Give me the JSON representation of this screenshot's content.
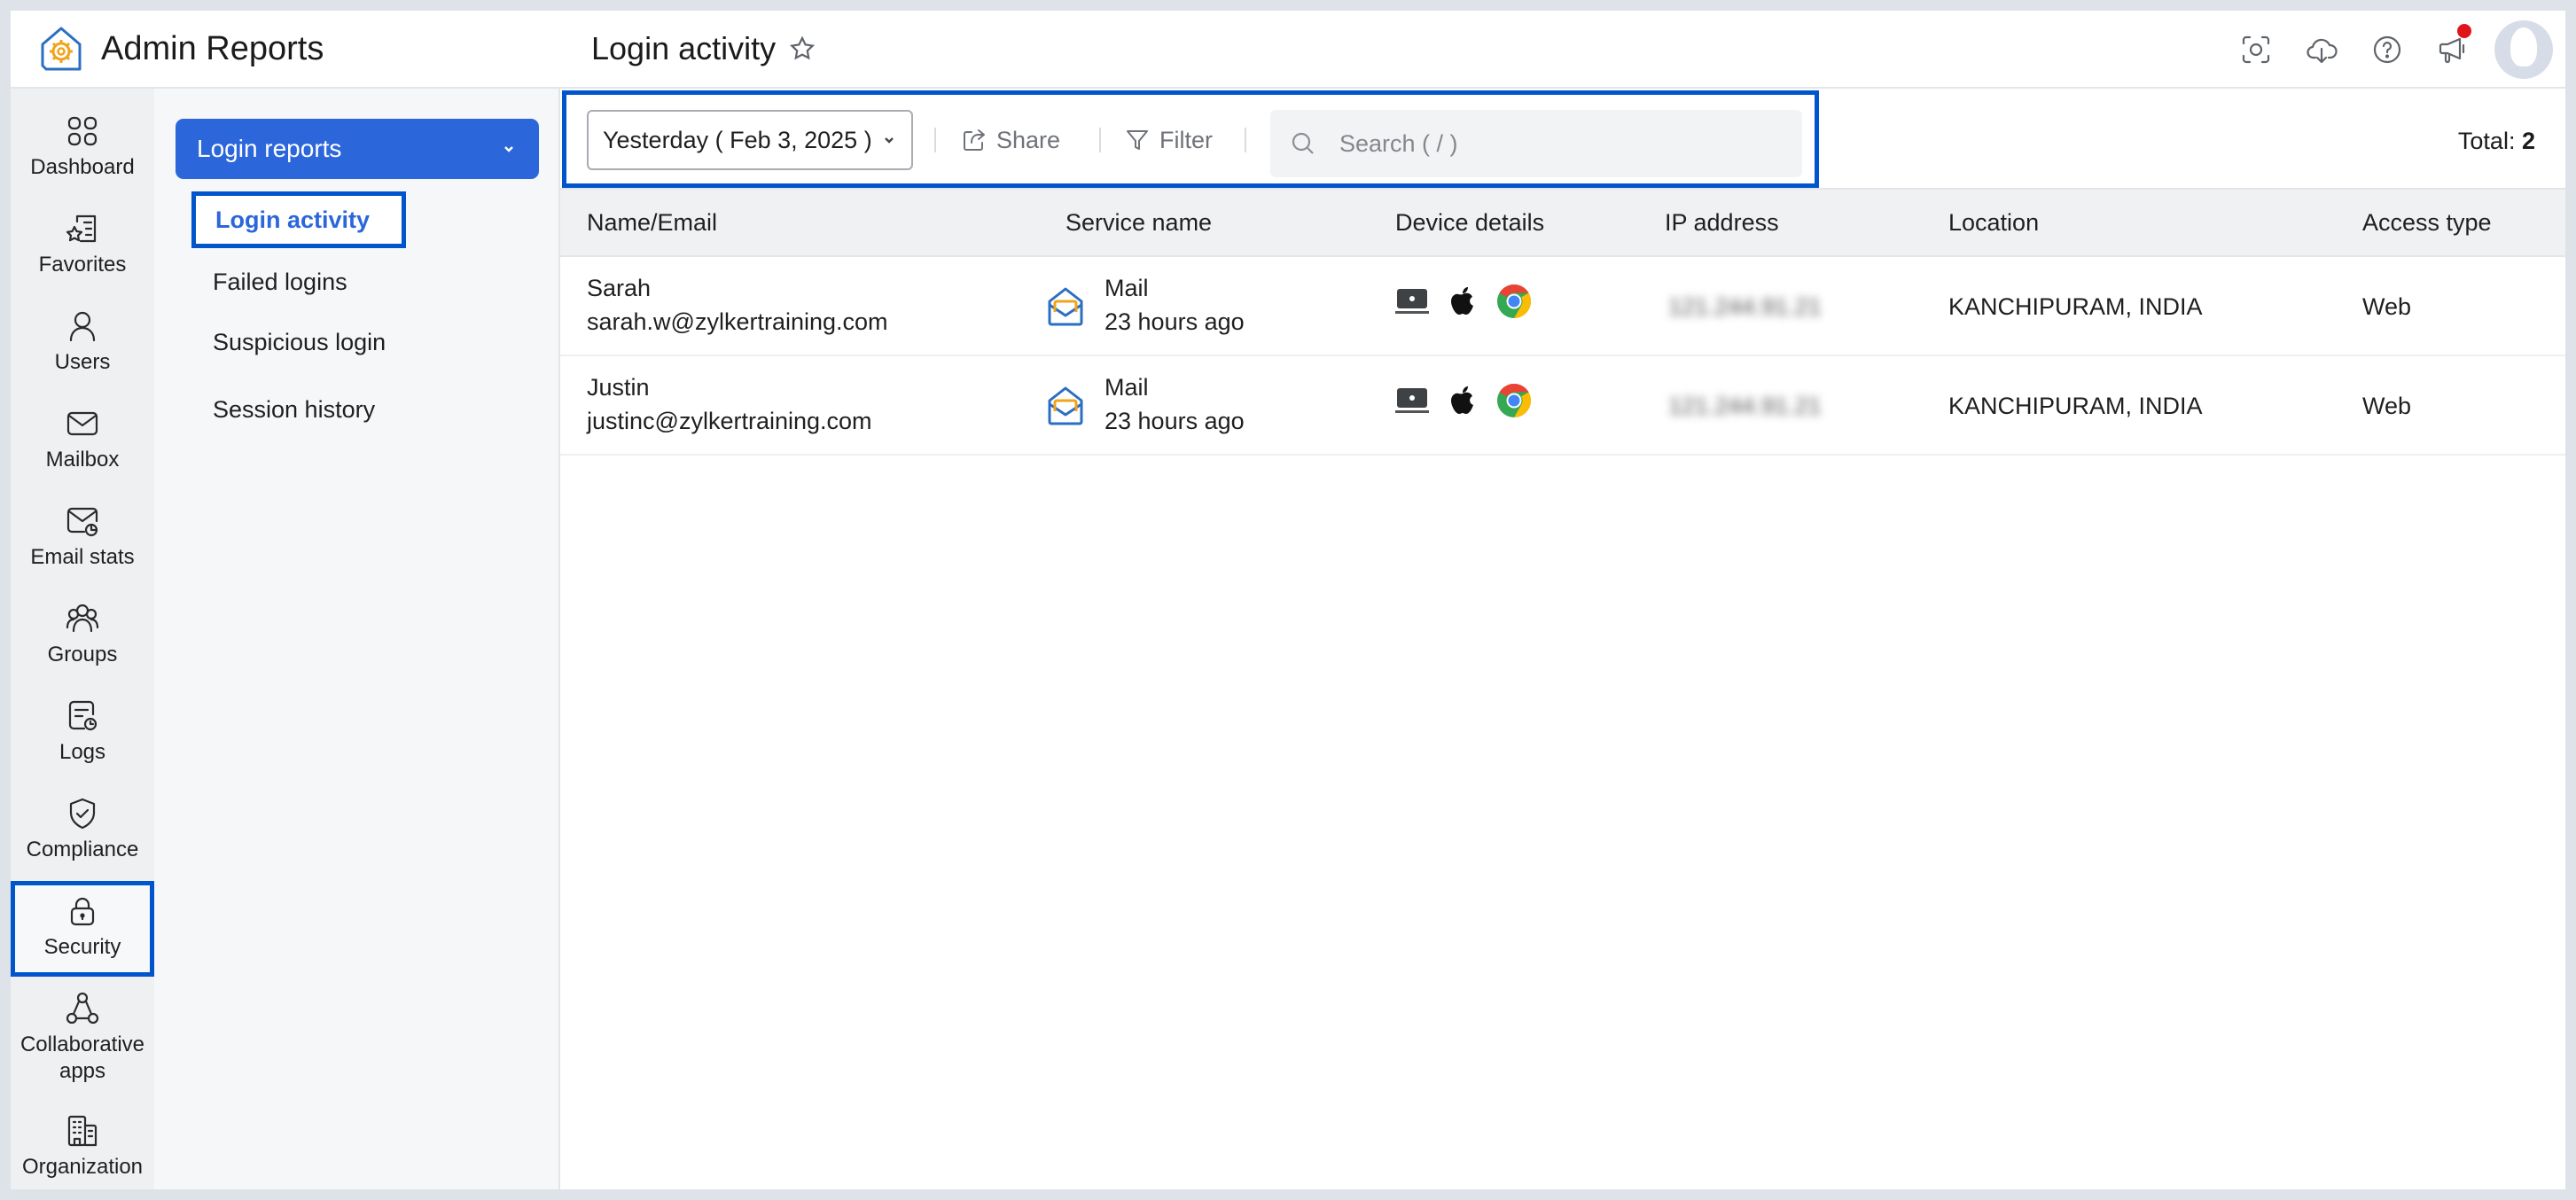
{
  "app": {
    "title": "Admin Reports",
    "logo_icon": "admin-reports-logo-icon"
  },
  "rail": {
    "items": [
      {
        "label": "Dashboard",
        "icon": "dashboard-grid-icon",
        "active": false
      },
      {
        "label": "Favorites",
        "icon": "favorites-star-list-icon",
        "active": false
      },
      {
        "label": "Users",
        "icon": "user-icon",
        "active": false
      },
      {
        "label": "Mailbox",
        "icon": "mail-envelope-icon",
        "active": false
      },
      {
        "label": "Email stats",
        "icon": "email-stats-icon",
        "active": false
      },
      {
        "label": "Groups",
        "icon": "groups-icon",
        "active": false
      },
      {
        "label": "Logs",
        "icon": "logs-icon",
        "active": false
      },
      {
        "label": "Compliance",
        "icon": "shield-check-icon",
        "active": false
      },
      {
        "label": "Security",
        "icon": "lock-icon",
        "active": true
      },
      {
        "label": "Collaborative apps",
        "icon": "collaborative-apps-icon",
        "active": false
      },
      {
        "label": "Organization",
        "icon": "organization-building-icon",
        "active": false
      }
    ]
  },
  "subnav": {
    "section_label": "Login reports",
    "items": [
      {
        "label": "Login activity",
        "active": true
      },
      {
        "label": "Failed logins",
        "active": false
      },
      {
        "label": "Suspicious login",
        "active": false
      },
      {
        "label": "Session history",
        "active": false
      }
    ]
  },
  "header": {
    "page_title": "Login activity",
    "icons": [
      "screenshot-capture-icon",
      "cloud-download-icon",
      "help-icon",
      "announcement-megaphone-icon",
      "avatar"
    ],
    "notification_dot_color": "#e0151b"
  },
  "toolbar": {
    "date_filter": "Yesterday ( Feb 3, 2025 )",
    "share_label": "Share",
    "filter_label": "Filter",
    "search_placeholder": "Search ( / )",
    "total_label": "Total:",
    "total_value": "2"
  },
  "table": {
    "columns": [
      "Name/Email",
      "Service name",
      "Device details",
      "IP address",
      "Location",
      "Access type"
    ],
    "rows": [
      {
        "name": "Sarah",
        "email": "sarah.w@zylkertraining.com",
        "service": "Mail",
        "time": "23 hours ago",
        "devices": [
          "mac-laptop-icon",
          "apple-icon",
          "chrome-icon"
        ],
        "ip": "121.244.91.21",
        "location": "KANCHIPURAM, INDIA",
        "access_type": "Web"
      },
      {
        "name": "Justin",
        "email": "justinc@zylkertraining.com",
        "service": "Mail",
        "time": "23 hours ago",
        "devices": [
          "mac-laptop-icon",
          "apple-icon",
          "chrome-icon"
        ],
        "ip": "121.244.91.21",
        "location": "KANCHIPURAM, INDIA",
        "access_type": "Web"
      }
    ]
  },
  "colors": {
    "accent": "#2c66db",
    "highlight_border": "#0055cc"
  }
}
